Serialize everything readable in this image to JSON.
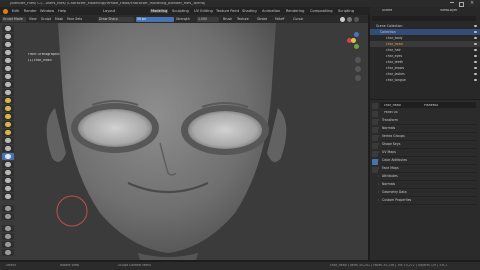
{
  "window": {
    "title": "[Blender_Files/ C:/...users_files/ /Character_Modeling/Female_Head/character_modeling_blender_files_.blend]"
  },
  "menu": {
    "items": [
      "Blender",
      "Edit",
      "Render",
      "Window",
      "Help",
      "Layout",
      "Modeling",
      "Sculpting",
      "UV Editing",
      "Texture Paint",
      "Shading",
      "Animation",
      "Rendering",
      "Compositing",
      "Scripting"
    ]
  },
  "header": {
    "mode": "Sculpt Mode",
    "view": "View",
    "sculpt": "Sculpt",
    "mask": "Mask",
    "face_sets": "Face Sets",
    "brush": "Draw Sharp",
    "radius_label": "Radius",
    "radius": "50 px",
    "strength_label": "Strength",
    "strength": "1.000",
    "brush_menu": "Brush",
    "texture": "Texture",
    "stroke": "Stroke",
    "falloff": "Falloff",
    "cursor": "Cursor"
  },
  "viewport": {
    "view_label": "Front Orthographic",
    "object_label": "(1) char_head"
  },
  "outliner": {
    "header": "Scene",
    "view_layer": "ViewLayer",
    "rows": [
      "Scene Collection",
      "Collection",
      "char_body",
      "char_head",
      "char_hair",
      "char_eyes",
      "char_teeth",
      "char_brows",
      "char_lashes",
      "char_tongue"
    ]
  },
  "properties": {
    "object_name": "char_head",
    "active_name": "PlaneMD",
    "panel_title": "Panel 04",
    "sections": [
      "Transform",
      "Normals",
      "Vertex Groups",
      "Shape Keys",
      "UV Maps",
      "Color Attributes",
      "Face Maps",
      "Attributes",
      "Normals",
      "Geometry Data",
      "Custom Properties"
    ]
  },
  "status": {
    "left": "Select",
    "middle": "Rotate View",
    "right_hint": "Sculpt Context Menu",
    "stats": "char_head | Verts 35,241 | Faces 35,136 | Tris 70,272 | Objects 1/9 | 3.6.1"
  },
  "colors": {
    "accent": "#4772b3",
    "active_tool": "#4772b3",
    "brush_circle": "#c0504d"
  }
}
